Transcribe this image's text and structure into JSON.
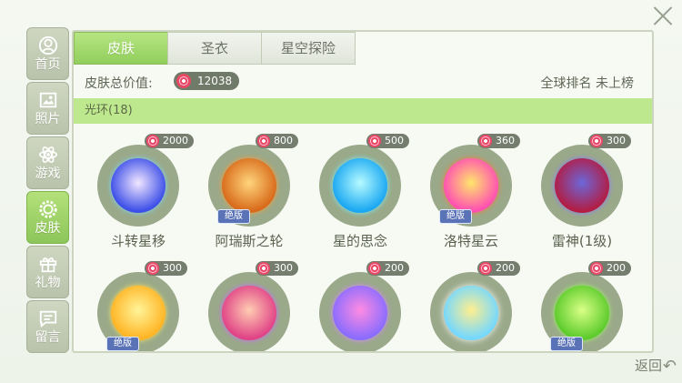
{
  "sidebar": {
    "items": [
      {
        "label": "首页",
        "icon": "user-icon",
        "active": false
      },
      {
        "label": "照片",
        "icon": "photo-icon",
        "active": false
      },
      {
        "label": "游戏",
        "icon": "atom-icon",
        "active": false
      },
      {
        "label": "皮肤",
        "icon": "gear-icon",
        "active": true
      },
      {
        "label": "礼物",
        "icon": "gift-icon",
        "active": false
      },
      {
        "label": "留言",
        "icon": "message-icon",
        "active": false
      }
    ]
  },
  "tabs": [
    {
      "label": "皮肤",
      "active": true
    },
    {
      "label": "圣衣",
      "active": false
    },
    {
      "label": "星空探险",
      "active": false
    }
  ],
  "info": {
    "total_label": "皮肤总价值:",
    "total_value": "12038",
    "rank": "全球排名 未上榜"
  },
  "category": {
    "label": "光环(18)"
  },
  "items_row1": [
    {
      "name": "斗转星移",
      "price": "2000",
      "badge": "",
      "colors": [
        "#f2e7ff",
        "#3d4fe8"
      ]
    },
    {
      "name": "阿瑞斯之轮",
      "price": "800",
      "badge": "绝版",
      "colors": [
        "#ffd57c",
        "#d86a1a"
      ]
    },
    {
      "name": "星的思念",
      "price": "500",
      "badge": "",
      "colors": [
        "#b6fbff",
        "#1aa8f2"
      ]
    },
    {
      "name": "洛特星云",
      "price": "360",
      "badge": "绝版",
      "colors": [
        "#ffe66b",
        "#ff4fb2"
      ]
    },
    {
      "name": "雷神(1级)",
      "price": "300",
      "badge": "",
      "colors": [
        "#6b67d9",
        "#b21d44"
      ]
    }
  ],
  "items_row2": [
    {
      "price": "300",
      "badge": "绝版",
      "colors": [
        "#fff59a",
        "#ffb424"
      ]
    },
    {
      "price": "300",
      "badge": "",
      "colors": [
        "#ffcdb2",
        "#e04386"
      ]
    },
    {
      "price": "200",
      "badge": "",
      "colors": [
        "#ff8be2",
        "#8a6cff"
      ]
    },
    {
      "price": "200",
      "badge": "",
      "colors": [
        "#ffef8f",
        "#74d8ff"
      ]
    },
    {
      "price": "200",
      "badge": "绝版",
      "colors": [
        "#d9ff86",
        "#5ccb2b"
      ]
    }
  ],
  "back_label": "返回"
}
